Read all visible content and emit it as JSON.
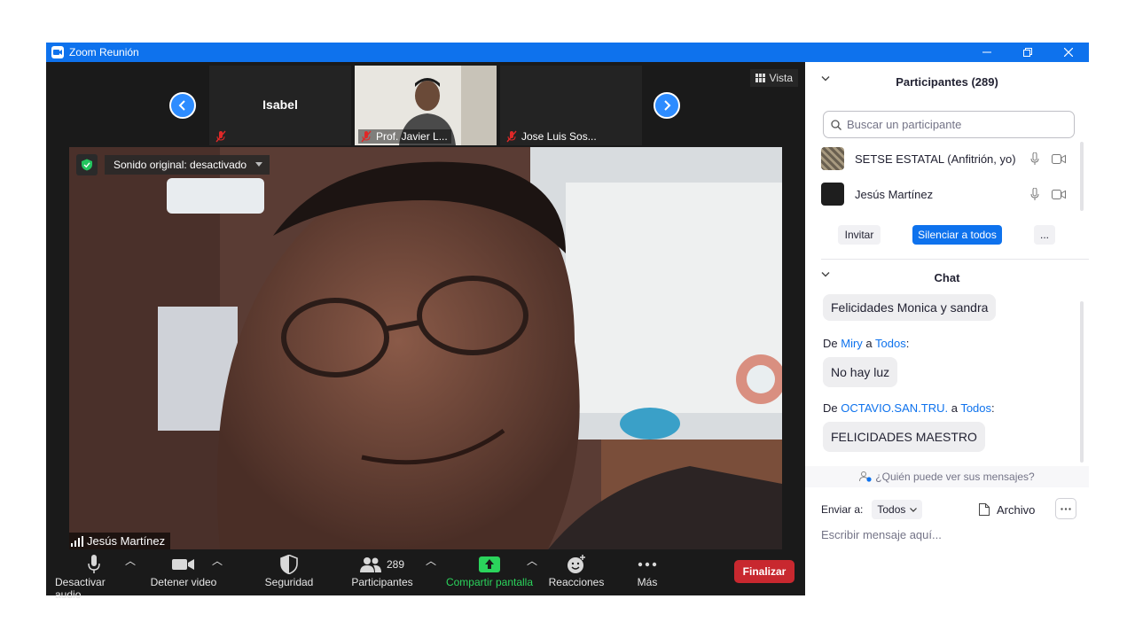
{
  "window": {
    "title": "Zoom Reunión"
  },
  "strip": {
    "tiles": [
      {
        "name": "Isabel"
      },
      {
        "name": "Prof. Javier L..."
      },
      {
        "name": "Jose Luis Sos..."
      }
    ],
    "view_label": "Vista"
  },
  "main_video": {
    "sound_label": "Sonido original: desactivado",
    "speaker_name": "Jesús  Martínez"
  },
  "toolbar": {
    "audio_label": "Desactivar audio",
    "video_label": "Detener video",
    "security_label": "Seguridad",
    "participants_label": "Participantes",
    "participants_count": "289",
    "share_label": "Compartir pantalla",
    "reactions_label": "Reacciones",
    "more_label": "Más",
    "end_label": "Finalizar"
  },
  "participants_panel": {
    "title": "Participantes (289)",
    "search_placeholder": "Buscar un participante",
    "items": [
      {
        "name": "SETSE ESTATAL (Anfitrión, yo)"
      },
      {
        "name": "Jesús  Martínez"
      }
    ],
    "invite_label": "Invitar",
    "mute_all_label": "Silenciar a todos",
    "more_label": "..."
  },
  "chat": {
    "title": "Chat",
    "messages": [
      {
        "text": "Felicidades Monica y sandra"
      },
      {
        "prefix": "De ",
        "sender": "Miry",
        "middle": " a ",
        "target": "Todos",
        "suffix": ":",
        "text": "No hay luz"
      },
      {
        "prefix": "De ",
        "sender": "OCTAVIO.SAN.TRU.",
        "middle": " a ",
        "target": "Todos",
        "suffix": ":",
        "text": "FELICIDADES MAESTRO"
      }
    ],
    "who_sees": "¿Quién puede ver sus mensajes?",
    "send_to_label": "Enviar a:",
    "send_to_value": "Todos",
    "file_label": "Archivo",
    "input_placeholder": "Escribir mensaje aquí..."
  },
  "colors": {
    "accent": "#0e72ed",
    "end": "#c8282f",
    "share_green": "#2bd45c"
  }
}
